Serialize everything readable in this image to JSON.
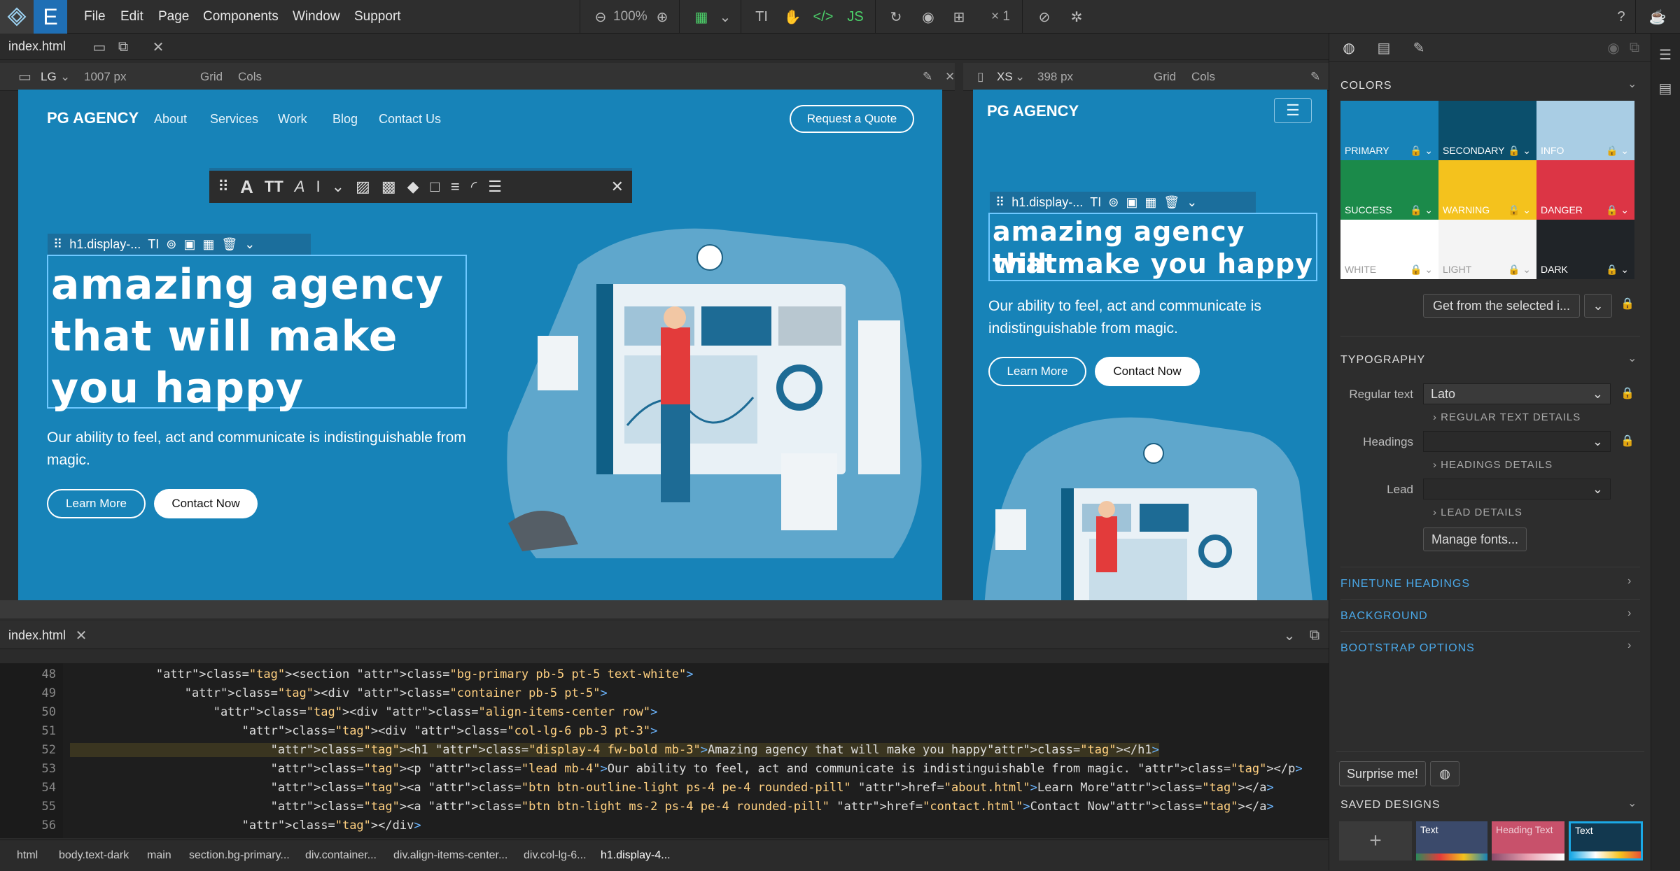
{
  "app": {
    "menu": [
      "File",
      "Edit",
      "Page",
      "Components",
      "Window",
      "Support"
    ],
    "zoom": "100%",
    "count": "× 1"
  },
  "editor": {
    "file_tab": "index.html"
  },
  "lg_view": {
    "size": "LG",
    "width": "1007 px",
    "grid": "Grid",
    "cols": "Cols"
  },
  "xs_view": {
    "size": "XS",
    "width": "398 px",
    "grid": "Grid",
    "cols": "Cols"
  },
  "site": {
    "brand": "PG AGENCY",
    "nav": [
      "About",
      "Services",
      "Work",
      "Blog",
      "Contact Us"
    ],
    "cta": "Request a Quote",
    "headline_lg": [
      "Amazing agency",
      "that will make",
      "you happy"
    ],
    "headline_xs": [
      "Amazing agency that",
      "will make you happy"
    ],
    "lead_lg": [
      "Our ability to feel, act and communicate is indistinguishable from",
      "magic."
    ],
    "lead_xs": [
      "Our ability to feel, act and communicate is",
      "indistinguishable from magic."
    ],
    "btn_learn": "Learn More",
    "btn_contact": "Contact Now",
    "selected_tag": "h1.display-..."
  },
  "code": {
    "tab": "index.html",
    "lines": [
      {
        "n": "48",
        "code": "            <section class=\"bg-primary pb-5 pt-5 text-white\">"
      },
      {
        "n": "49",
        "code": "                <div class=\"container pb-5 pt-5\">"
      },
      {
        "n": "50",
        "code": "                    <div class=\"align-items-center row\">"
      },
      {
        "n": "51",
        "code": "                        <div class=\"col-lg-6 pb-3 pt-3\">"
      },
      {
        "n": "52",
        "code": "                            <h1 class=\"display-4 fw-bold mb-3\">Amazing agency that will make you happy</h1>"
      },
      {
        "n": "53",
        "code": "                            <p class=\"lead mb-4\">Our ability to feel, act and communicate is indistinguishable from magic. </p>"
      },
      {
        "n": "54",
        "code": "                            <a class=\"btn btn-outline-light ps-4 pe-4 rounded-pill\" href=\"about.html\">Learn More</a>"
      },
      {
        "n": "55",
        "code": "                            <a class=\"btn btn-light ms-2 ps-4 pe-4 rounded-pill\" href=\"contact.html\">Contact Now</a>"
      },
      {
        "n": "56",
        "code": "                        </div>"
      }
    ]
  },
  "breadcrumbs": [
    "html",
    "body.text-dark",
    "main",
    "section.bg-primary...",
    "div.container...",
    "div.align-items-center...",
    "div.col-lg-6...",
    "h1.display-4..."
  ],
  "panel": {
    "colors_title": "COLORS",
    "swatches": [
      {
        "label": "PRIMARY",
        "color": "#1783b8"
      },
      {
        "label": "SECONDARY",
        "color": "#0b4f6c"
      },
      {
        "label": "INFO",
        "color": "#a9cde4"
      },
      {
        "label": "SUCCESS",
        "color": "#1b8a4a"
      },
      {
        "label": "WARNING",
        "color": "#f4c21d"
      },
      {
        "label": "DANGER",
        "color": "#dc3545"
      },
      {
        "label": "WHITE",
        "color": "#ffffff"
      },
      {
        "label": "LIGHT",
        "color": "#f4f4f4"
      },
      {
        "label": "DARK",
        "color": "#202428"
      }
    ],
    "get_from": "Get from the selected i...",
    "typography_title": "TYPOGRAPHY",
    "regular_label": "Regular text",
    "regular_value": "Lato",
    "regular_details": "REGULAR TEXT DETAILS",
    "headings_label": "Headings",
    "headings_details": "HEADINGS DETAILS",
    "lead_label": "Lead",
    "lead_details": "LEAD DETAILS",
    "manage_fonts": "Manage fonts...",
    "finetune": "FINETUNE HEADINGS",
    "background": "BACKGROUND",
    "bootstrap": "BOOTSTRAP OPTIONS",
    "surprise": "Surprise me!",
    "saved_title": "SAVED DESIGNS",
    "saved": [
      {
        "label": "Text"
      },
      {
        "label": "Heading Text"
      },
      {
        "label": "Text"
      }
    ]
  }
}
